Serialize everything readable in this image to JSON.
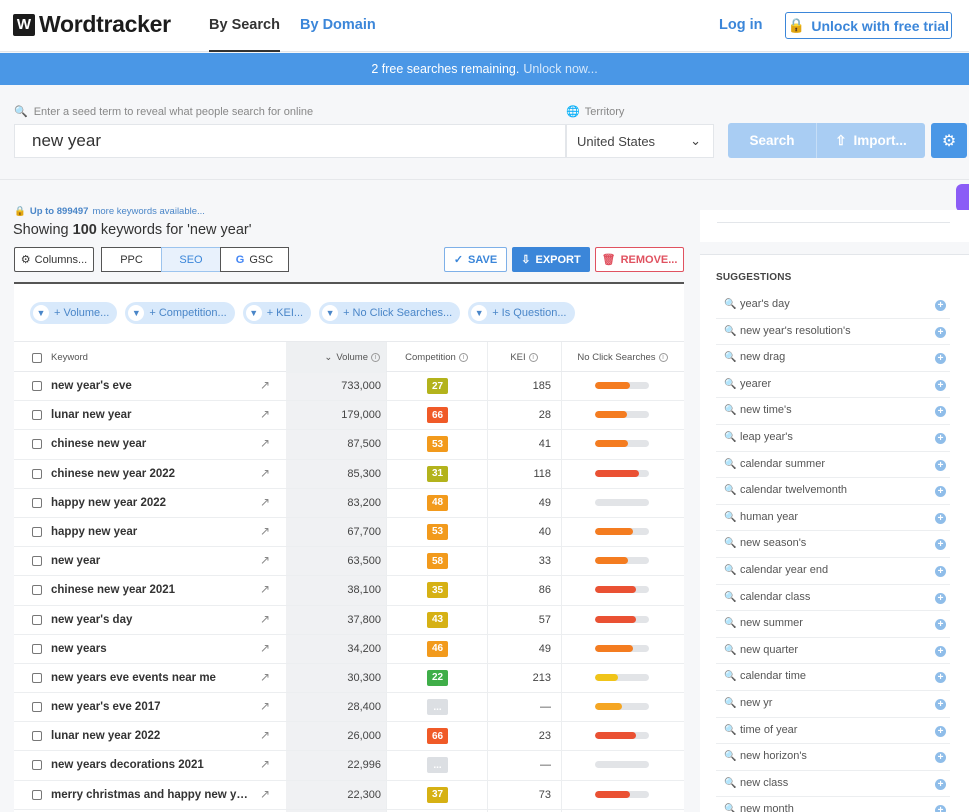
{
  "brand": {
    "logo_mark": "W",
    "name": "Wordtracker"
  },
  "nav": {
    "tab_active": "By Search",
    "tab_other": "By Domain",
    "login": "Log in",
    "unlock": "Unlock with free trial"
  },
  "banner": {
    "text": "2 free searches remaining.",
    "link": "Unlock now..."
  },
  "search": {
    "hint": "Enter a seed term to reveal what people search for online",
    "territory_label": "Territory",
    "value": "new year",
    "territory": "United States",
    "search_button": "Search",
    "import_button": "Import..."
  },
  "results": {
    "more_prefix": "Up to 899497",
    "more_suffix": "more keywords available...",
    "showing_prefix": "Showing",
    "showing_count": "100",
    "showing_suffix": "keywords for 'new year'"
  },
  "toolbar": {
    "columns": "Columns...",
    "ppc": "PPC",
    "seo": "SEO",
    "gsc": "GSC",
    "save": "SAVE",
    "export": "EXPORT",
    "remove": "REMOVE..."
  },
  "filters": [
    "+ Volume...",
    "+ Competition...",
    "+ KEI...",
    "+ No Click Searches...",
    "+ Is Question..."
  ],
  "columns": {
    "keyword": "Keyword",
    "volume": "Volume",
    "competition": "Competition",
    "kei": "KEI",
    "ncs": "No Click Searches"
  },
  "colors": {
    "accent": "#3b86d9",
    "banner": "#4a97e6",
    "remove": "#e05260",
    "settings_icon": "gear-icon"
  },
  "rows": [
    {
      "keyword": "new year's eve",
      "volume": "733,000",
      "competition": "27",
      "comp_color": "#b3b31c",
      "kei": "185",
      "ncs": 0.65,
      "ncs_color": "#f47c20"
    },
    {
      "keyword": "lunar new year",
      "volume": "179,000",
      "competition": "66",
      "comp_color": "#f05a28",
      "kei": "28",
      "ncs": 0.6,
      "ncs_color": "#f47c20"
    },
    {
      "keyword": "chinese new year",
      "volume": "87,500",
      "competition": "53",
      "comp_color": "#f29a1c",
      "kei": "41",
      "ncs": 0.62,
      "ncs_color": "#f47c20"
    },
    {
      "keyword": "chinese new year 2022",
      "volume": "85,300",
      "competition": "31",
      "comp_color": "#b3b31c",
      "kei": "118",
      "ncs": 0.82,
      "ncs_color": "#ea5133"
    },
    {
      "keyword": "happy new year 2022",
      "volume": "83,200",
      "competition": "48",
      "comp_color": "#f29a1c",
      "kei": "49",
      "ncs": 0,
      "ncs_color": "#f47c20"
    },
    {
      "keyword": "happy new year",
      "volume": "67,700",
      "competition": "53",
      "comp_color": "#f29a1c",
      "kei": "40",
      "ncs": 0.7,
      "ncs_color": "#f47c20"
    },
    {
      "keyword": "new year",
      "volume": "63,500",
      "competition": "58",
      "comp_color": "#f29a1c",
      "kei": "33",
      "ncs": 0.62,
      "ncs_color": "#f47c20"
    },
    {
      "keyword": "chinese new year 2021",
      "volume": "38,100",
      "competition": "35",
      "comp_color": "#d6b114",
      "kei": "86",
      "ncs": 0.75,
      "ncs_color": "#ea5133"
    },
    {
      "keyword": "new year's day",
      "volume": "37,800",
      "competition": "43",
      "comp_color": "#d6b114",
      "kei": "57",
      "ncs": 0.75,
      "ncs_color": "#ea5133"
    },
    {
      "keyword": "new years",
      "volume": "34,200",
      "competition": "46",
      "comp_color": "#f29a1c",
      "kei": "49",
      "ncs": 0.7,
      "ncs_color": "#f47c20"
    },
    {
      "keyword": "new years eve events near me",
      "volume": "30,300",
      "competition": "22",
      "comp_color": "#3fae49",
      "kei": "213",
      "ncs": 0.42,
      "ncs_color": "#f0c419"
    },
    {
      "keyword": "new year's eve 2017",
      "volume": "28,400",
      "competition": "...",
      "comp_color": "#dcdfe3",
      "kei": "—",
      "ncs": 0.5,
      "ncs_color": "#f5a623"
    },
    {
      "keyword": "lunar new year 2022",
      "volume": "26,000",
      "competition": "66",
      "comp_color": "#f05a28",
      "kei": "23",
      "ncs": 0.75,
      "ncs_color": "#ea5133"
    },
    {
      "keyword": "new years decorations 2021",
      "volume": "22,996",
      "competition": "...",
      "comp_color": "#dcdfe3",
      "kei": "—",
      "ncs": 0,
      "ncs_color": "#f47c20"
    },
    {
      "keyword": "merry christmas and happy new year",
      "volume": "22,300",
      "competition": "37",
      "comp_color": "#d6b114",
      "kei": "73",
      "ncs": 0.65,
      "ncs_color": "#ea5133"
    }
  ],
  "suggestions": {
    "title": "SUGGESTIONS",
    "items": [
      "year's day",
      "new year's resolution's",
      "new drag",
      "yearer",
      "new time's",
      "leap year's",
      "calendar summer",
      "calendar twelvemonth",
      "human year",
      "new season's",
      "calendar year end",
      "calendar class",
      "new summer",
      "new quarter",
      "calendar time",
      "new yr",
      "time of year",
      "new horizon's",
      "new class",
      "new month"
    ]
  }
}
